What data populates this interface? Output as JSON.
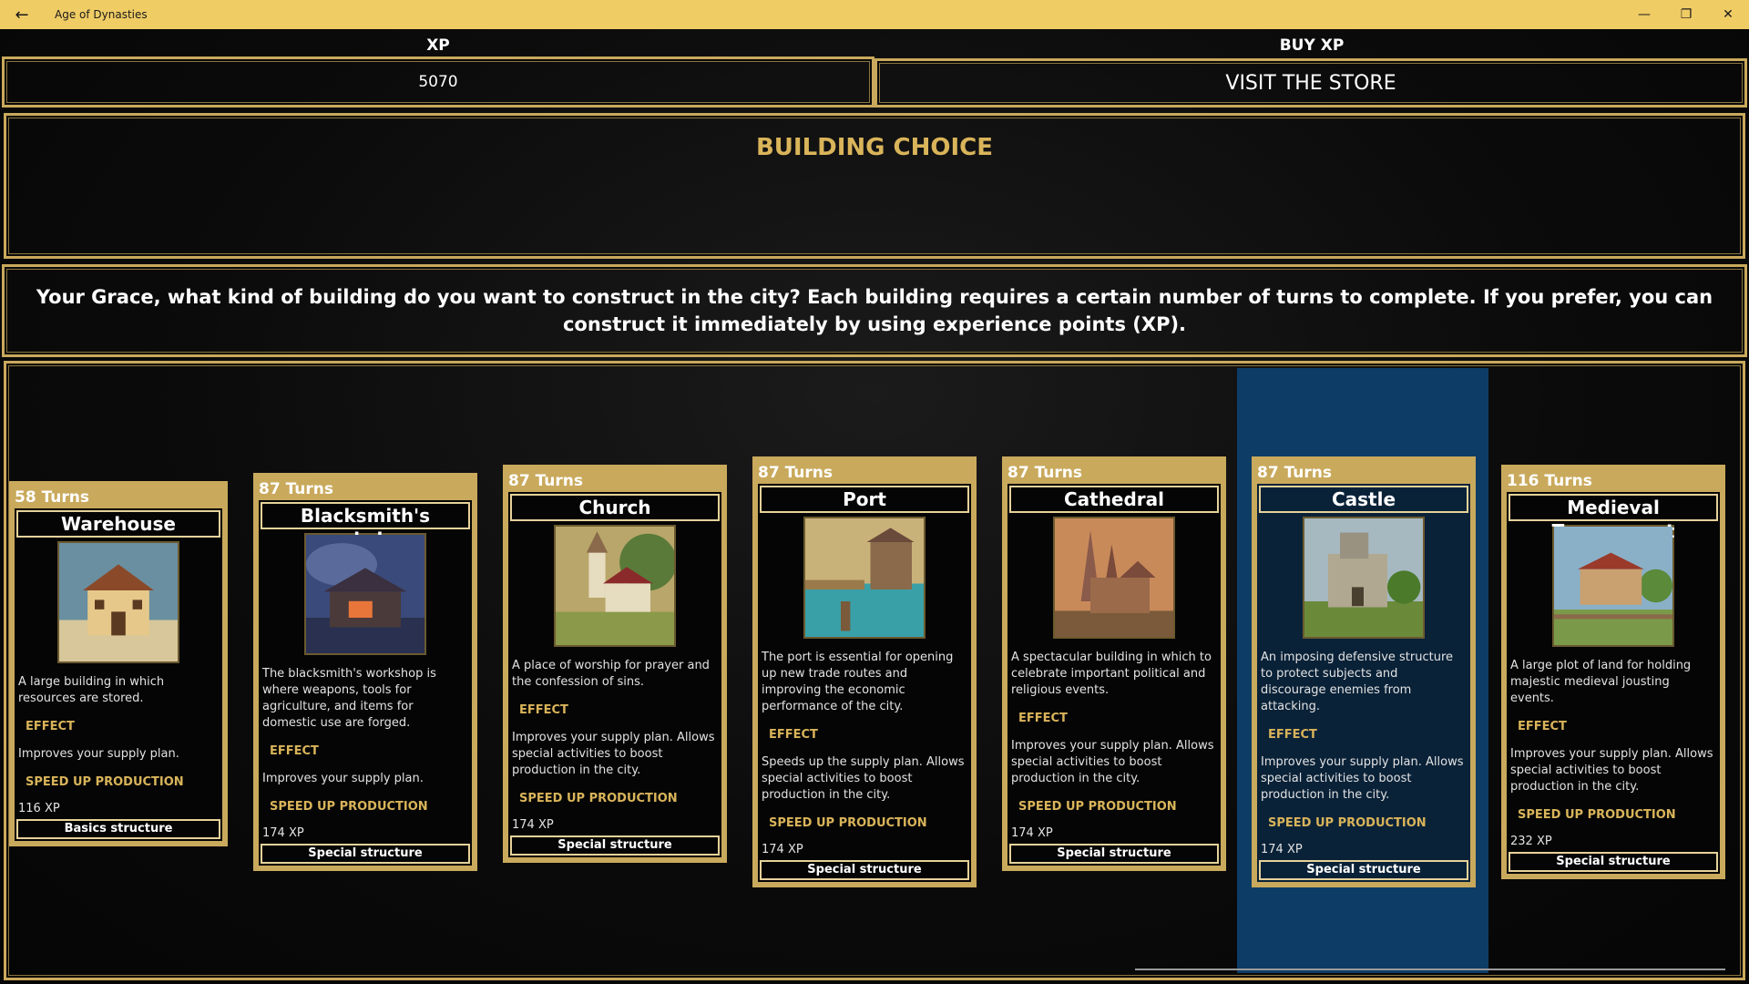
{
  "window": {
    "title": "Age of Dynasties",
    "back_icon": "←",
    "minimize_icon": "—",
    "restore_icon": "❐",
    "close_icon": "✕"
  },
  "header": {
    "xp_label": "XP",
    "xp_value": "5070",
    "buy_label": "BUY XP",
    "store_button": "VISIT THE STORE"
  },
  "choice": {
    "title": "BUILDING CHOICE",
    "prompt": "Your Grace, what kind of building do you want to construct in the city? Each building requires a certain number of turns to complete. If you prefer, you can construct it immediately by using experience points (XP)."
  },
  "cards": [
    {
      "turns": "58 Turns",
      "name": "Warehouse",
      "desc": "A large building in which resources are stored.",
      "effect_label": "EFFECT",
      "effect": "Improves your supply plan.",
      "speed_label": "SPEED UP PRODUCTION",
      "cost": "116 XP",
      "type": "Basics structure",
      "image_icon": "warehouse-image"
    },
    {
      "turns": "87 Turns",
      "name": "Blacksmith's workshop",
      "desc": "The blacksmith's workshop is where weapons, tools for agriculture, and items for domestic use are forged.",
      "effect_label": "EFFECT",
      "effect": "Improves your supply plan.",
      "speed_label": "SPEED UP PRODUCTION",
      "cost": "174 XP",
      "type": "Special structure",
      "image_icon": "blacksmith-image"
    },
    {
      "turns": "87 Turns",
      "name": "Church",
      "desc": "A place of worship for prayer and the confession of sins.",
      "effect_label": "EFFECT",
      "effect": "Improves your supply plan. Allows special activities to boost production in the city.",
      "speed_label": "SPEED UP PRODUCTION",
      "cost": "174 XP",
      "type": "Special structure",
      "image_icon": "church-image"
    },
    {
      "turns": "87 Turns",
      "name": "Port",
      "desc": "The port is essential for opening up new trade routes and improving the economic performance of the city.",
      "effect_label": "EFFECT",
      "effect": "Speeds up the supply plan. Allows special activities to boost production in the city.",
      "speed_label": "SPEED UP PRODUCTION",
      "cost": "174 XP",
      "type": "Special structure",
      "image_icon": "port-image"
    },
    {
      "turns": "87 Turns",
      "name": "Cathedral",
      "desc": "A spectacular building in which to celebrate important political and religious events.",
      "effect_label": "EFFECT",
      "effect": "Improves your supply plan. Allows special activities to boost production in the city.",
      "speed_label": "SPEED UP PRODUCTION",
      "cost": "174 XP",
      "type": "Special structure",
      "image_icon": "cathedral-image"
    },
    {
      "turns": "87 Turns",
      "name": "Castle",
      "desc": "An imposing defensive structure to protect subjects and discourage enemies from attacking.",
      "effect_label": "EFFECT",
      "effect": "Improves your supply plan. Allows special activities to boost production in the city.",
      "speed_label": "SPEED UP PRODUCTION",
      "cost": "174 XP",
      "type": "Special structure",
      "image_icon": "castle-image"
    },
    {
      "turns": "116 Turns",
      "name": "Medieval Tournament",
      "desc": "A large plot of land for holding majestic medieval jousting events.",
      "effect_label": "EFFECT",
      "effect": "Improves your supply plan. Allows special activities to boost production in the city.",
      "speed_label": "SPEED UP PRODUCTION",
      "cost": "232 XP",
      "type": "Special structure",
      "image_icon": "tournament-image"
    }
  ],
  "colors": {
    "gold": "#c9a95c",
    "title_bar": "#f0cc65",
    "selected": "#0d3d66"
  }
}
